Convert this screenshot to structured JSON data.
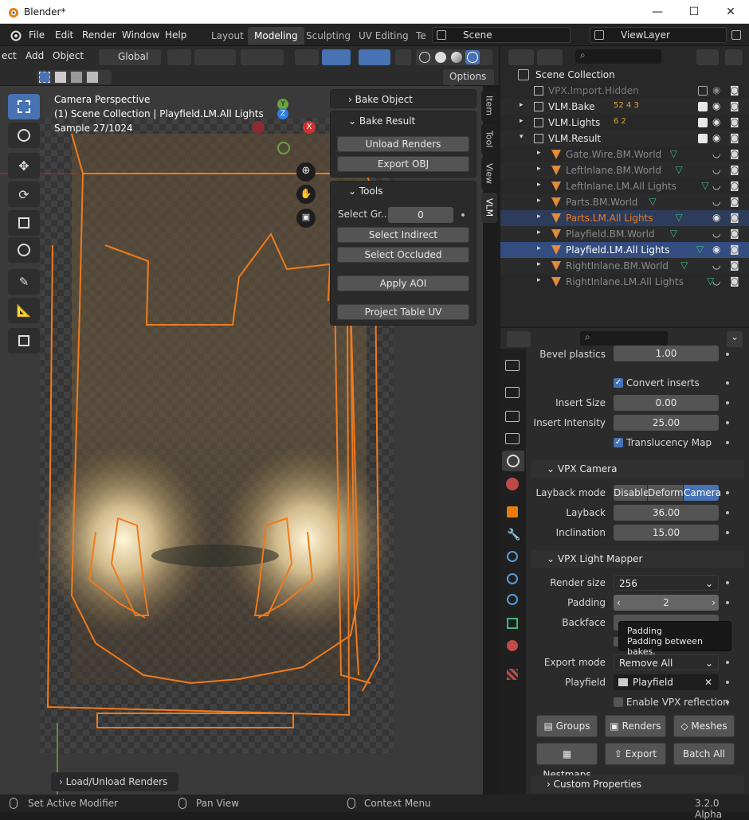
{
  "window": {
    "title": "Blender*",
    "min": "—",
    "max": "☐",
    "close": "✕"
  },
  "menu": {
    "items": [
      "File",
      "Edit",
      "Render",
      "Window",
      "Help"
    ],
    "workspaces": [
      "Layout",
      "Modeling",
      "Sculpting",
      "UV Editing",
      "Te"
    ],
    "active_workspace": "Modeling",
    "scene": "Scene",
    "view_layer": "ViewLayer"
  },
  "viewport_header": {
    "left_cut": "ect",
    "add": "Add",
    "object": "Object",
    "orientation": "Global",
    "options": "Options"
  },
  "viewport": {
    "overlay_line1": "Camera Perspective",
    "overlay_line2": "(1) Scene Collection | Playfield.LM.All Lights",
    "overlay_line3": "Sample 27/1024",
    "bottom_panel": "Load/Unload Renders",
    "gizmo": {
      "x": "X",
      "y": "Y",
      "z": "Z"
    }
  },
  "npanel": {
    "bake_object": "Bake Object",
    "bake_result": "Bake Result",
    "unload_renders": "Unload Renders",
    "export_obj": "Export OBJ",
    "tools": "Tools",
    "select_group_label": "Select Gr...",
    "select_group_value": "0",
    "select_indirect": "Select Indirect",
    "select_occluded": "Select Occluded",
    "apply_aoi": "Apply AOI",
    "project_table_uv": "Project Table UV",
    "tabs": [
      "Item",
      "Tool",
      "View",
      "VLM"
    ]
  },
  "outliner": {
    "root": "Scene Collection",
    "rows": [
      {
        "name": "VPX.Import.Hidden",
        "dim": true,
        "level": 1
      },
      {
        "name": "VLM.Bake",
        "level": 1,
        "badge": "52  4  3"
      },
      {
        "name": "VLM.Lights",
        "level": 1,
        "badge": "6  2"
      },
      {
        "name": "VLM.Result",
        "level": 1
      },
      {
        "name": "Gate.Wire.BM.World",
        "level": 2
      },
      {
        "name": "LeftInlane.BM.World",
        "level": 2
      },
      {
        "name": "LeftInlane.LM.All Lights",
        "level": 2
      },
      {
        "name": "Parts.BM.World",
        "level": 2
      },
      {
        "name": "Parts.LM.All Lights",
        "level": 2,
        "selected": true,
        "orange": true
      },
      {
        "name": "Playfield.BM.World",
        "level": 2
      },
      {
        "name": "Playfield.LM.All Lights",
        "level": 2,
        "active": true
      },
      {
        "name": "RightInlane.BM.World",
        "level": 2
      },
      {
        "name": "RightInlane.LM.All Lights",
        "level": 2
      }
    ]
  },
  "properties": {
    "bevel_plastics_label": "Bevel plastics",
    "bevel_plastics_value": "1.00",
    "convert_inserts": "Convert inserts",
    "insert_size_label": "Insert Size",
    "insert_size_value": "0.00",
    "insert_intensity_label": "Insert Intensity",
    "insert_intensity_value": "25.00",
    "translucency_map": "Translucency Map",
    "vpx_camera": "VPX Camera",
    "layback_mode_label": "Layback mode",
    "layback_modes": [
      "Disable",
      "Deform",
      "Camera"
    ],
    "layback_mode_active": "Camera",
    "layback_label": "Layback",
    "layback_value": "36.00",
    "inclination_label": "Inclination",
    "inclination_value": "15.00",
    "vpx_light_mapper": "VPX Light Mapper",
    "render_size_label": "Render size",
    "render_size_value": "256",
    "padding_label": "Padding",
    "padding_value": "2",
    "backface_label": "Backface",
    "tooltip_title": "Padding",
    "tooltip_body": "Padding between bakes.",
    "export_mode_label": "Export mode",
    "export_mode_value": "Remove All",
    "playfield_label": "Playfield",
    "playfield_value": "Playfield",
    "enable_vpx_reflection": "Enable VPX reflection",
    "groups": "Groups",
    "renders": "Renders",
    "meshes": "Meshes",
    "nestmaps": "Nestmaps",
    "export": "Export",
    "batch_all": "Batch All",
    "custom_properties": "Custom Properties"
  },
  "status": {
    "left": "Set Active Modifier",
    "mid": "Pan View",
    "right": "Context Menu",
    "version": "3.2.0 Alpha"
  },
  "colors": {
    "accent": "#4772b3",
    "orange": "#f07a1c",
    "selected_row": "#334d80"
  }
}
